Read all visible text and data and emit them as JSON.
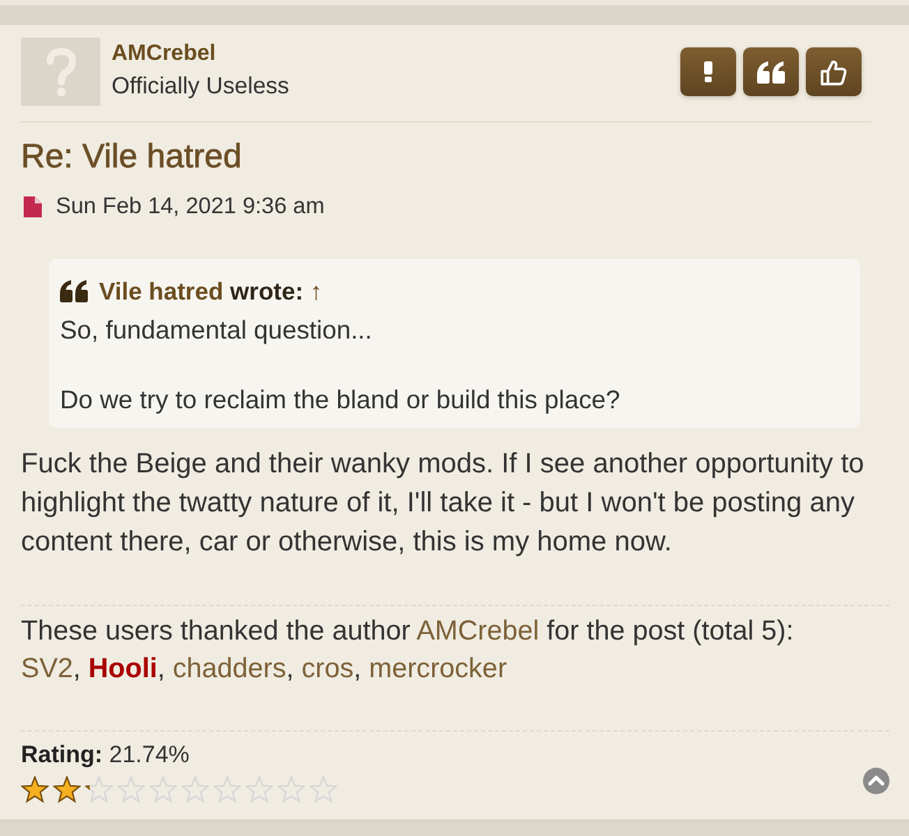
{
  "author": {
    "name": "AMCrebel",
    "rank": "Officially Useless"
  },
  "post": {
    "title": "Re: Vile hatred",
    "date": "Sun Feb 14, 2021 9:36 am"
  },
  "quote": {
    "author": "Vile hatred",
    "verb": "wrote:",
    "jump": "↑",
    "paragraphs": [
      "So, fundamental question...",
      "Do we try to reclaim the bland or build this place?"
    ]
  },
  "body": "Fuck the Beige and their wanky mods. If I see another opportunity to highlight the twatty nature of it, I'll take it - but I won't be posting any content there, car or otherwise, this is my home now.",
  "thanks": {
    "before": "These users thanked the author",
    "author": "AMCrebel",
    "after": "for the post (total 5):",
    "separator": ",",
    "users": [
      {
        "name": "SV2",
        "kind": "member",
        "color": "#7d6138"
      },
      {
        "name": "Hooli",
        "kind": "admin",
        "color": "#aa0000"
      },
      {
        "name": "chadders",
        "kind": "member",
        "color": "#7d6138"
      },
      {
        "name": "cros",
        "kind": "member",
        "color": "#7d6138"
      },
      {
        "name": "mercrocker",
        "kind": "member",
        "color": "#7d6138"
      }
    ]
  },
  "rating": {
    "text": "**Rating:** 21.74%",
    "stars": 2.17
  }
}
